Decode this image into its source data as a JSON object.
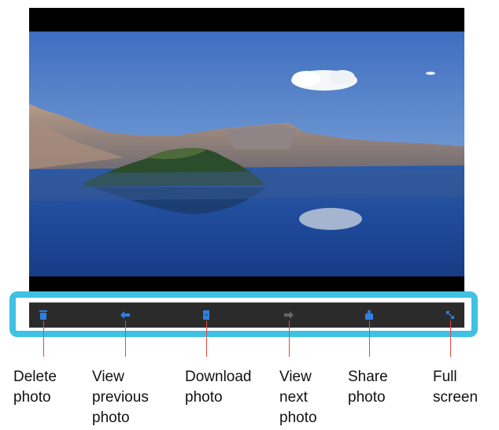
{
  "toolbar": {
    "buttons": [
      {
        "icon": "trash-icon",
        "color": "#2f7fe0"
      },
      {
        "icon": "arrow-left-icon",
        "color": "#2f7fe0"
      },
      {
        "icon": "download-icon",
        "color": "#2f7fe0"
      },
      {
        "icon": "arrow-right-icon",
        "color": "#666666"
      },
      {
        "icon": "share-icon",
        "color": "#2f7fe0"
      },
      {
        "icon": "fullscreen-icon",
        "color": "#2f7fe0"
      }
    ]
  },
  "annotations": {
    "highlight_color": "#3ec1e2",
    "pointer_color": "#e8483a",
    "labels": [
      "Delete\nphoto",
      "View\nprevious\nphoto",
      "Download\nphoto",
      "View\nnext\nphoto",
      "Share\nphoto",
      "Full\nscreen"
    ]
  }
}
